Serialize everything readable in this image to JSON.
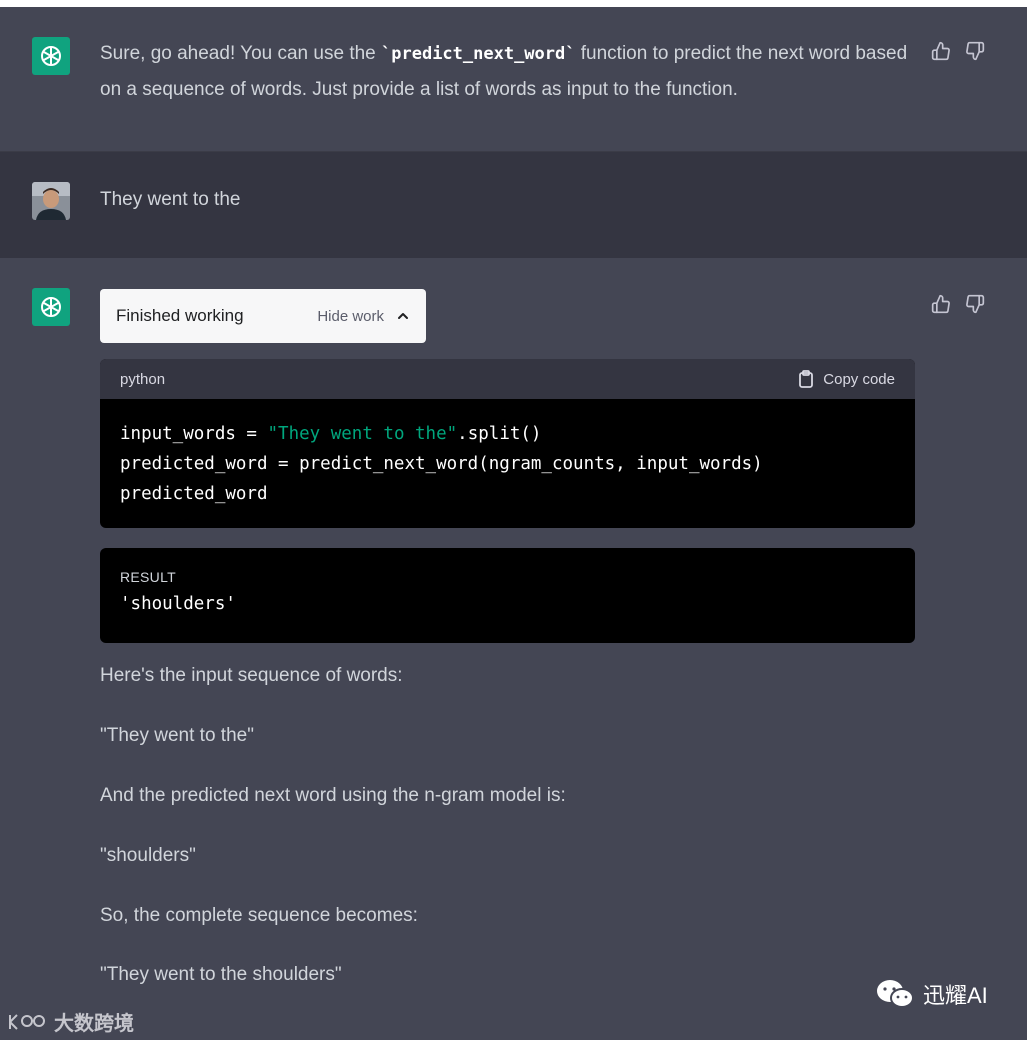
{
  "conversation": {
    "msg1": {
      "text_before": "Sure, go ahead! You can use the ",
      "code": "`predict_next_word`",
      "text_after": " function to predict the next word based on a sequence of words. Just provide a list of words as input to the function."
    },
    "msg2": {
      "text": "They went to the"
    },
    "msg3": {
      "work_status": "Finished working",
      "hide_work": "Hide work",
      "code": {
        "language": "python",
        "copy_label": "Copy code",
        "line1_a": "input_words = ",
        "line1_str": "\"They went to the\"",
        "line1_b": ".split()",
        "line2": "predicted_word = predict_next_word(ngram_counts, input_words)",
        "line3": "predicted_word"
      },
      "result": {
        "label": "RESULT",
        "value": "'shoulders'"
      },
      "paragraphs": [
        "Here's the input sequence of words:",
        "\"They went to the\"",
        "And the predicted next word using the n-gram model is:",
        "\"shoulders\"",
        "So, the complete sequence becomes:",
        "\"They went to the shoulders\""
      ]
    }
  },
  "watermarks": {
    "left": "大数跨境",
    "right": "迅耀AI"
  },
  "icons": [
    "openai-logo-icon",
    "thumbs-up-icon",
    "thumbs-down-icon",
    "chevron-up-icon",
    "clipboard-icon",
    "wechat-icon"
  ],
  "colors": {
    "assistant_bg": "#444654",
    "user_bg": "#343541",
    "brand": "#10a37f",
    "string": "#00a67d"
  }
}
